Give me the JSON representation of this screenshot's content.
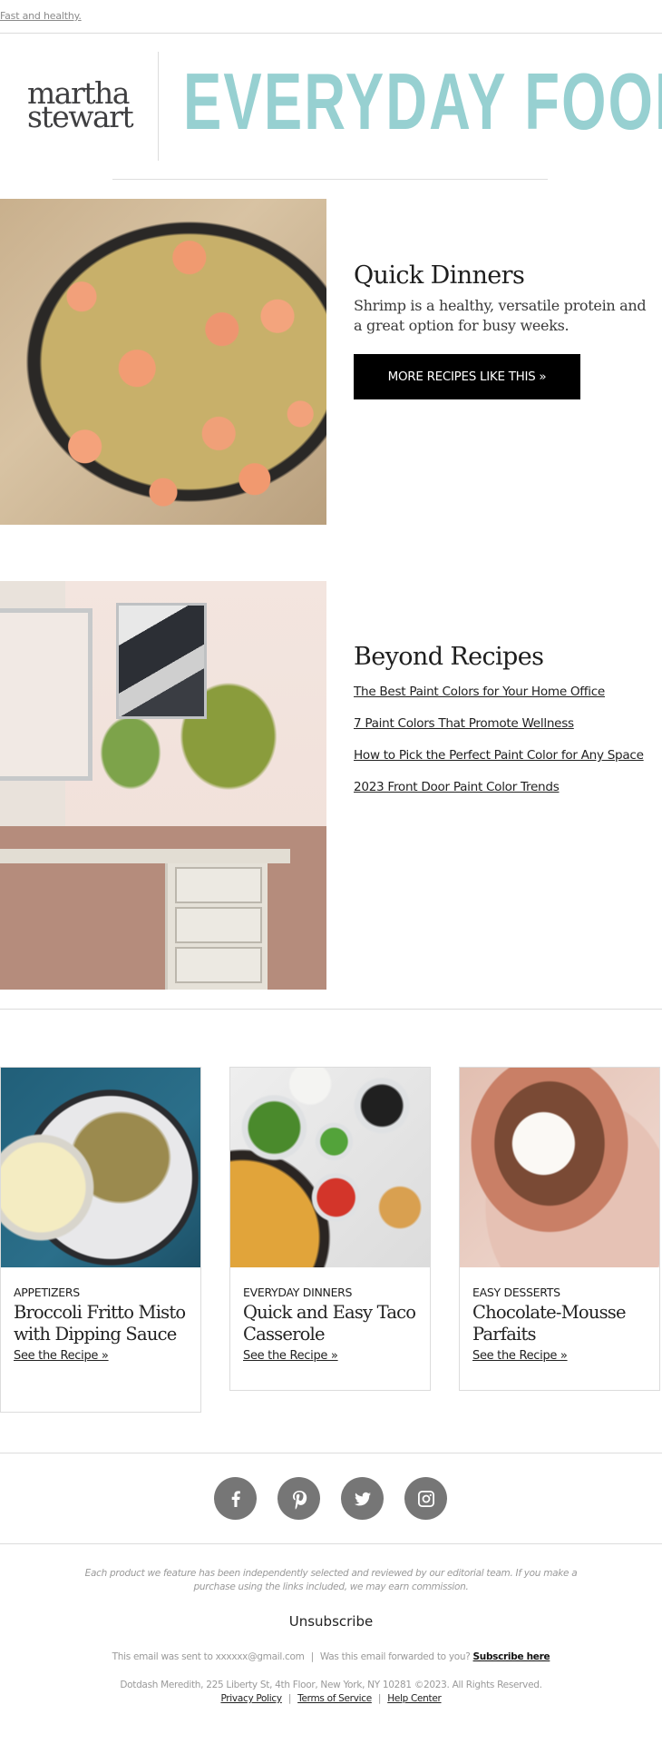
{
  "preheader": {
    "text": "Fast and healthy."
  },
  "header": {
    "brand_line1": "martha",
    "brand_line2": "stewart",
    "newsletter_title": "EVERYDAY FOOD",
    "newsletter_color": "#97d0d1"
  },
  "feature": {
    "image_alt": "Shrimp and couscous skillet with peas and zucchini",
    "title": "Quick Dinners",
    "description": "Shrimp is a healthy, versatile protein and a great option for busy weeks.",
    "cta_label": "MORE RECIPES LIKE THIS »"
  },
  "beyond": {
    "image_alt": "Home office desk with plants and framed art",
    "title": "Beyond Recipes",
    "links": [
      "The Best Paint Colors for Your Home Office",
      "7 Paint Colors That Promote Wellness",
      "How to Pick the Perfect Paint Color for Any Space",
      "2023 Front Door Paint Color Trends"
    ]
  },
  "cards": [
    {
      "category": "APPETIZERS",
      "title": "Broccoli Fritto Misto with Dipping Sauce",
      "link": "See the Recipe »",
      "image_alt": "Fried broccoli fritto misto with dipping sauce"
    },
    {
      "category": "EVERYDAY DINNERS",
      "title": "Quick and Easy Taco Casserole",
      "link": "See the Recipe »",
      "image_alt": "Taco casserole with toppings in bowls"
    },
    {
      "category": "EASY DESSERTS",
      "title": "Chocolate-Mousse Parfaits",
      "link": "See the Recipe »",
      "image_alt": "Chocolate mousse parfait topped with cream"
    }
  ],
  "social": [
    {
      "name": "facebook",
      "icon": "facebook-icon"
    },
    {
      "name": "pinterest",
      "icon": "pinterest-icon"
    },
    {
      "name": "twitter",
      "icon": "twitter-icon"
    },
    {
      "name": "instagram",
      "icon": "instagram-icon"
    }
  ],
  "footer": {
    "disclaimer": "Each product we feature has been independently selected and reviewed by our editorial team. If you make a purchase using the links included, we may earn commission.",
    "unsubscribe": "Unsubscribe",
    "sent_to_prefix": "This email was sent to xxxxxx@gmail.com",
    "separator": "|",
    "forwarded_question": "Was this email forwarded to you?",
    "subscribe_link": "Subscribe here",
    "address": "Dotdash Meredith, 225 Liberty St, 4th Floor, New York, NY 10281 ©2023. All Rights Reserved.",
    "links": [
      "Privacy Policy",
      "Terms of Service",
      "Help Center"
    ]
  },
  "colors": {
    "button_bg": "#000000",
    "social_icon_bg": "#767676",
    "divider": "#dcdcdc"
  }
}
